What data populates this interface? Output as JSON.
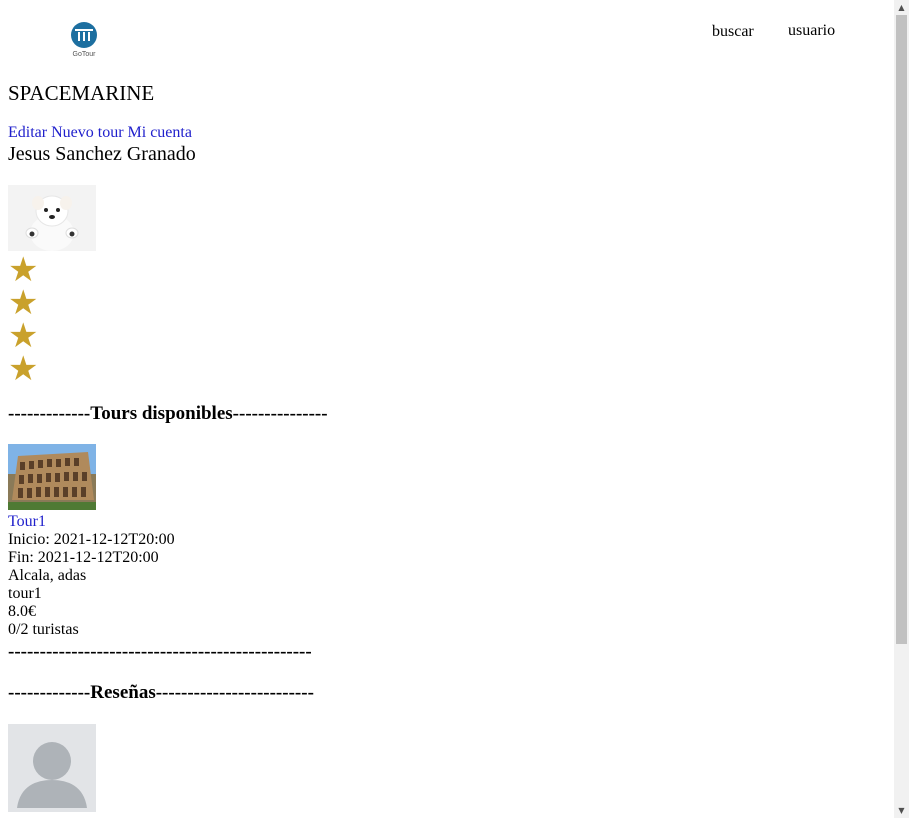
{
  "header": {
    "logo_text": "GoTour",
    "nav": {
      "buscar": "buscar",
      "usuario": "usuario"
    }
  },
  "site_title": "SPACEMARINE",
  "links": {
    "editar": "Editar",
    "nuevo_tour": "Nuevo tour",
    "mi_cuenta": "Mi cuenta"
  },
  "owner_name": "Jesus Sanchez Granado",
  "rating": {
    "stars": 4,
    "icon": "star-icon",
    "color": "#c9a12c"
  },
  "sections": {
    "tours": {
      "prefix": "-------------",
      "label": "Tours disponibles",
      "suffix": "---------------"
    },
    "resenas": {
      "prefix": "-------------",
      "label": "Reseñas",
      "suffix": "-------------------------"
    }
  },
  "tour": {
    "name": "Tour1",
    "inicio": "Inicio: 2021-12-12T20:00",
    "fin": "Fin: 2021-12-12T20:00",
    "location": "Alcala, adas",
    "description": "tour1",
    "price": "8.0€",
    "turistas": "0/2 turistas",
    "separator": "------------------------------------------------"
  }
}
